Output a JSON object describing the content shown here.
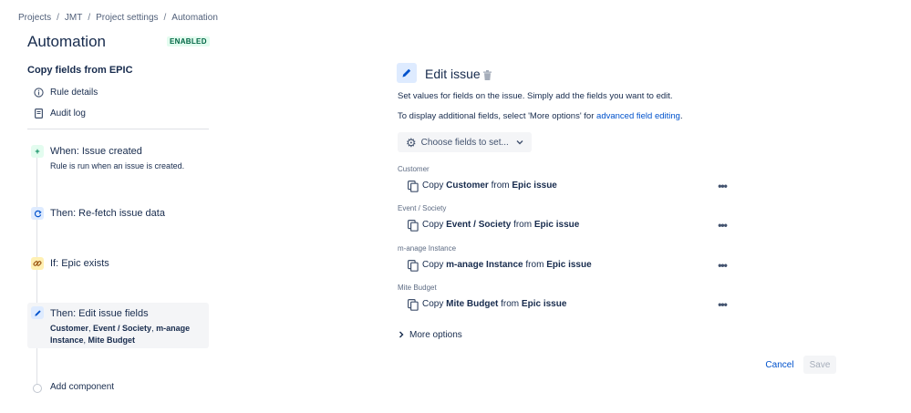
{
  "breadcrumb": [
    "Projects",
    "JMT",
    "Project settings",
    "Automation"
  ],
  "page_title": "Automation",
  "status_badge": "ENABLED",
  "rule": {
    "name": "Copy fields from EPIC",
    "nav": [
      {
        "label": "Rule details",
        "icon": "info-icon"
      },
      {
        "label": "Audit log",
        "icon": "document-icon"
      }
    ]
  },
  "steps": [
    {
      "title": "When: Issue created",
      "subtitle": "Rule is run when an issue is created.",
      "icon": "plus-icon",
      "color": "#E3FCEF"
    },
    {
      "title": "Then: Re-fetch issue data",
      "icon": "refresh-icon",
      "color": "#DEEBFF"
    },
    {
      "title": "If: Epic exists",
      "icon": "link-icon",
      "color": "#FFF0B3"
    },
    {
      "title": "Then: Edit issue fields",
      "subtitle_parts": [
        "Customer",
        ", ",
        "Event / Society",
        ", ",
        "m-anage",
        " ",
        "Instance",
        ", ",
        "Mite Budget"
      ],
      "icon": "pencil-icon",
      "color": "#DEEBFF"
    }
  ],
  "add_component": "Add component",
  "editor": {
    "title": "Edit issue",
    "description1": "Set values for fields on the issue. Simply add the fields you want to edit.",
    "description2_prefix": "To display additional fields, select 'More options' for ",
    "description2_link": "advanced field editing",
    "description2_suffix": ".",
    "choose_fields_label": "Choose fields to set...",
    "fields": [
      {
        "label": "Customer",
        "copy_word": "Copy",
        "field": "Customer",
        "from_word": "from",
        "source": "Epic issue"
      },
      {
        "label": "Event / Society",
        "copy_word": "Copy",
        "field": "Event / Society",
        "from_word": "from",
        "source": "Epic issue"
      },
      {
        "label": "m-anage Instance",
        "copy_word": "Copy",
        "field": "m-anage Instance",
        "from_word": "from",
        "source": "Epic issue"
      },
      {
        "label": "Mite Budget",
        "copy_word": "Copy",
        "field": "Mite Budget",
        "from_word": "from",
        "source": "Epic issue"
      }
    ],
    "more_dots": "•••",
    "more_options": "More options",
    "cancel": "Cancel",
    "save": "Save"
  }
}
